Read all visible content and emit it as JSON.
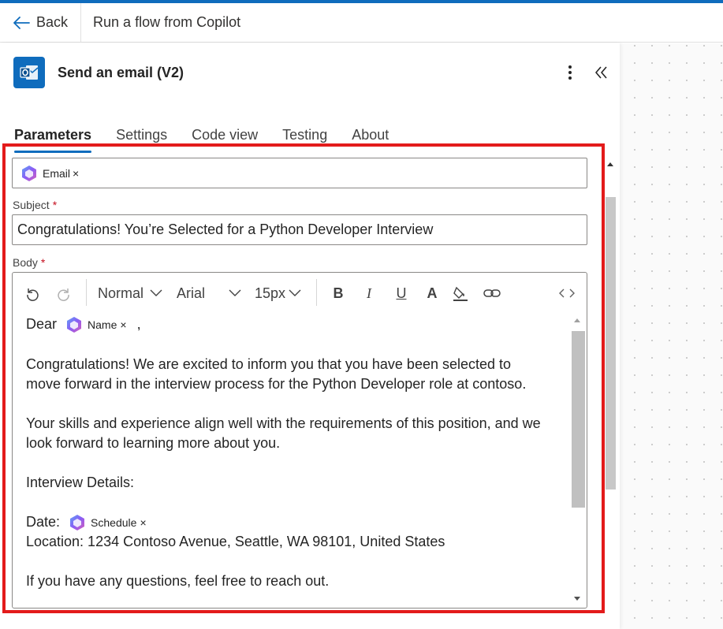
{
  "header": {
    "back_label": "Back",
    "title": "Run a flow from Copilot"
  },
  "action": {
    "title": "Send an email (V2)",
    "icon": "outlook-icon",
    "accent_color": "#0f6cbd"
  },
  "tabs": [
    {
      "label": "Parameters",
      "active": true
    },
    {
      "label": "Settings",
      "active": false
    },
    {
      "label": "Code view",
      "active": false
    },
    {
      "label": "Testing",
      "active": false
    },
    {
      "label": "About",
      "active": false
    }
  ],
  "to_field": {
    "token_label": "Email",
    "token_remove": "×"
  },
  "subject": {
    "label": "Subject",
    "required_mark": "*",
    "value": "Congratulations! You’re Selected for a Python Developer Interview"
  },
  "body": {
    "label": "Body",
    "required_mark": "*",
    "toolbar": {
      "paragraph_style": "Normal",
      "font": "Arial",
      "font_size": "15px",
      "bold": "B",
      "italic": "I",
      "underline": "U",
      "font_color": "A"
    },
    "content": {
      "greeting": "Dear",
      "name_token": "Name",
      "greeting_suffix": ",",
      "para1_line1": "Congratulations! We are excited to inform you that you have been selected to",
      "para1_line2": "move forward in the interview process for the Python Developer role at contoso.",
      "para2_line1": "Your skills and experience align well with the requirements of this position, and we",
      "para2_line2": "look forward to learning more about you.",
      "details_heading": "Interview Details:",
      "date_label": "Date:",
      "schedule_token": "Schedule",
      "location": "Location: 1234 Contoso Avenue, Seattle, WA 98101, United States",
      "closing": "If you have any questions, feel free to reach out."
    },
    "token_remove": "×"
  },
  "colors": {
    "highlight": "#e31b1b",
    "accent": "#0f6cbd"
  }
}
